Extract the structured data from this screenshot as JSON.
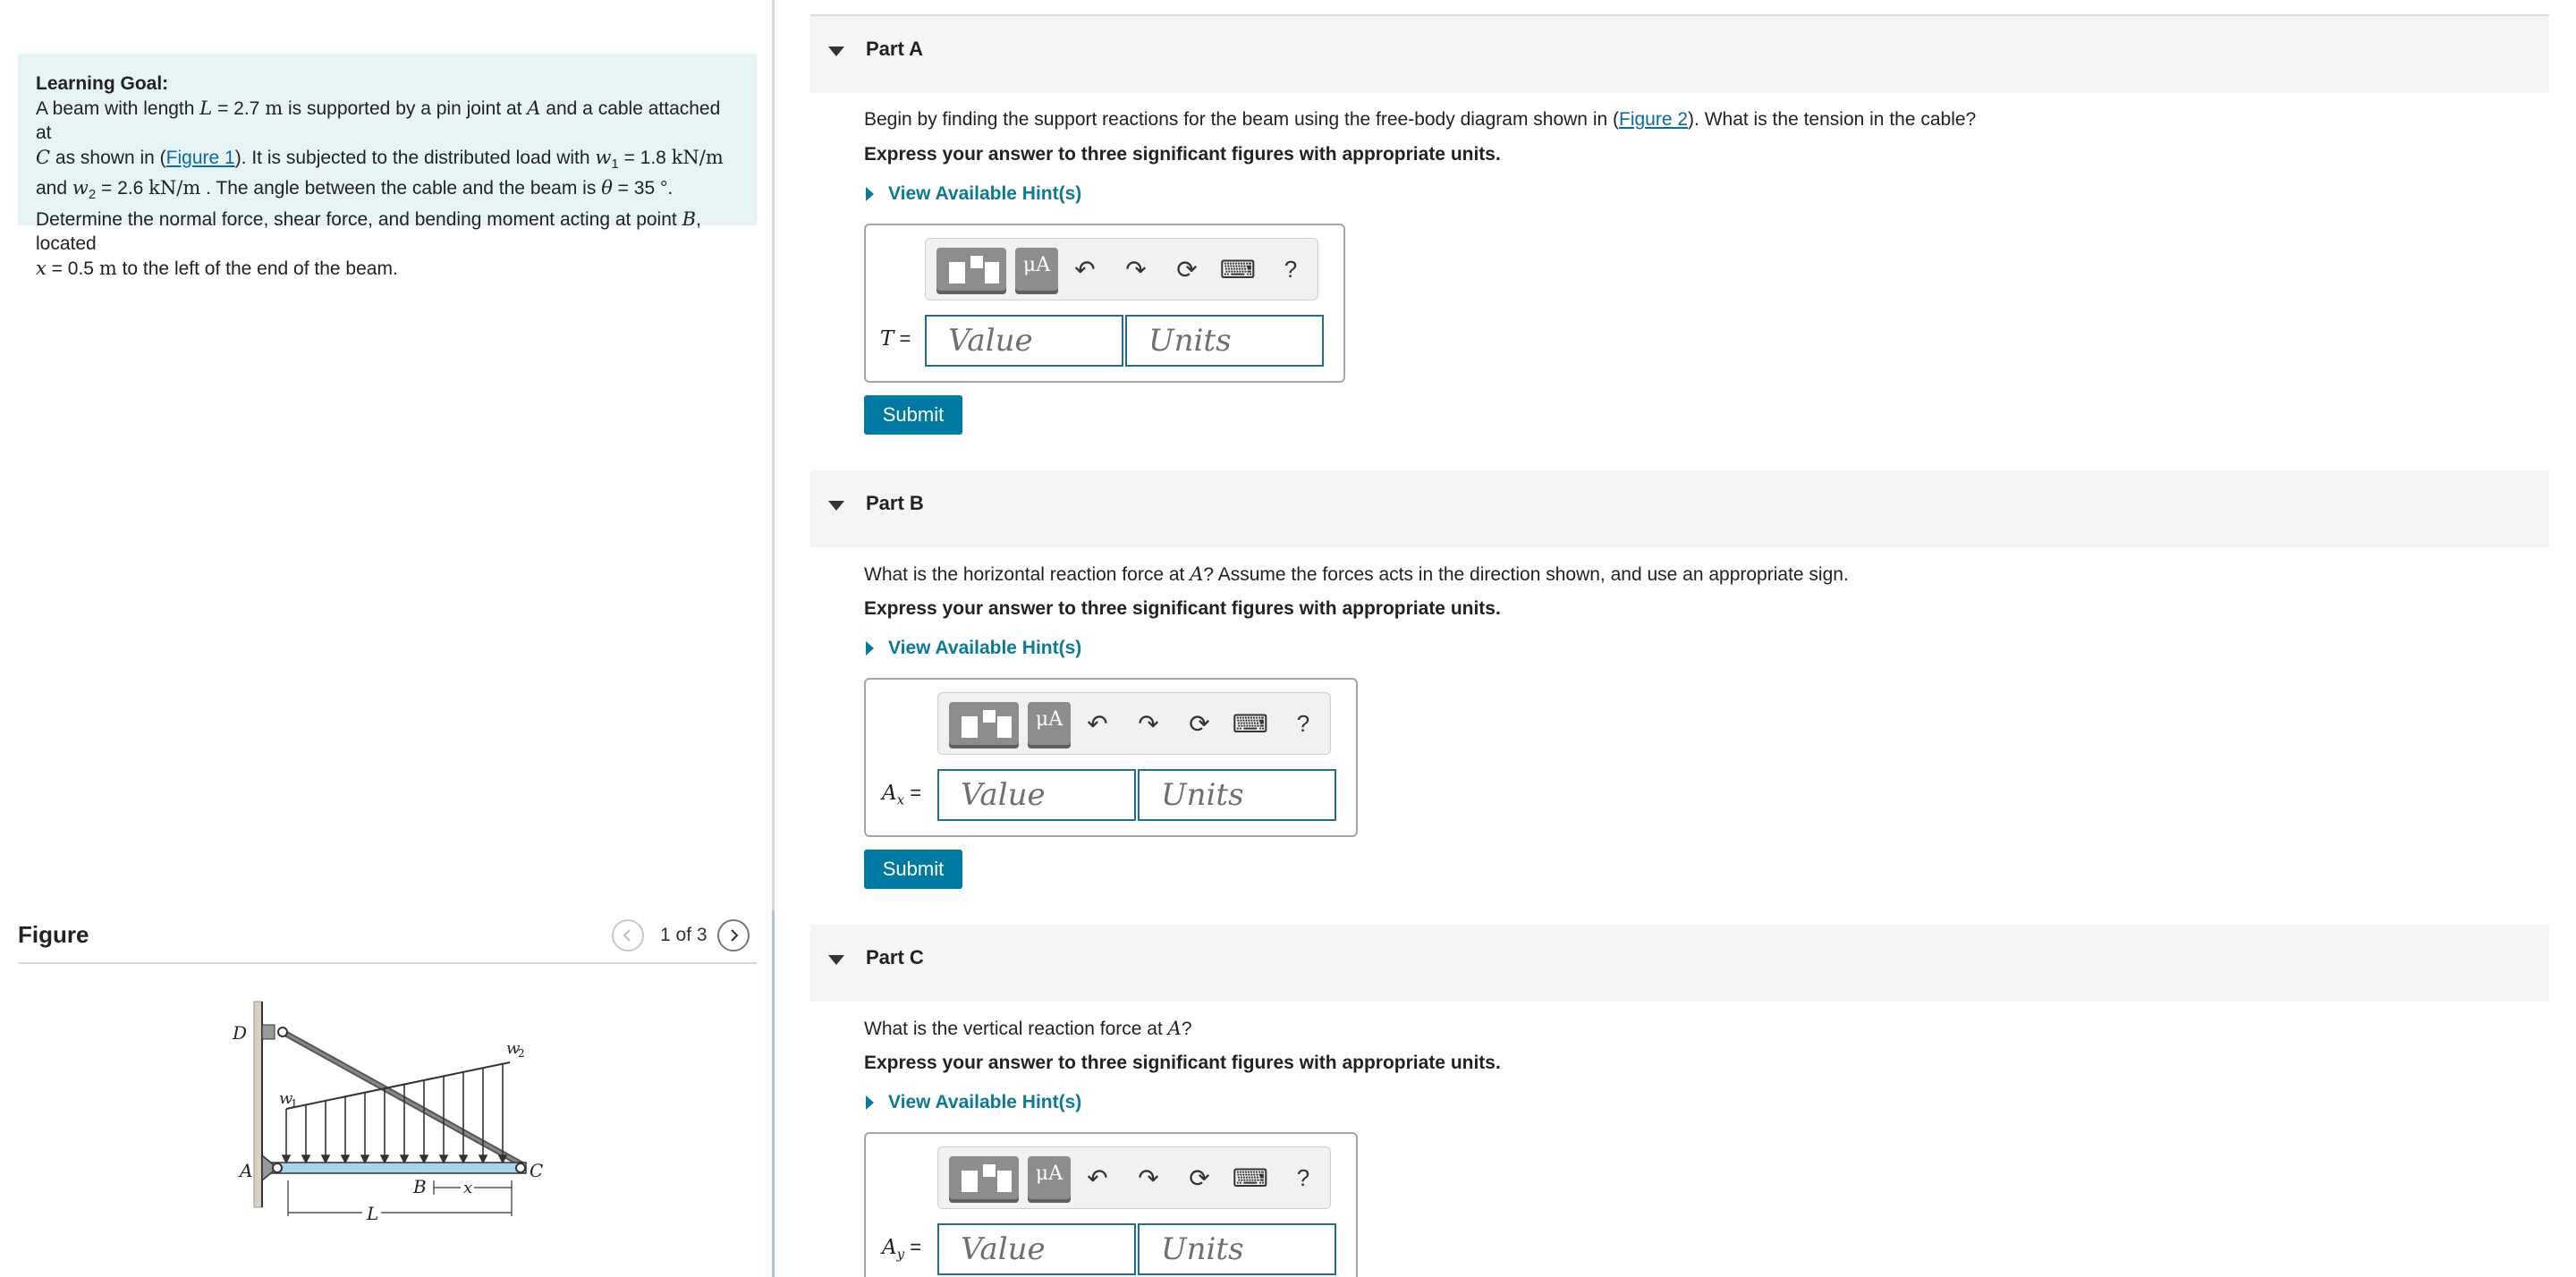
{
  "learning_goal": {
    "title": "Learning Goal:",
    "segments": {
      "s1": "A beam with length ",
      "L": "L",
      "s2": " = 2.7 ",
      "m1": "m",
      "s3": " is supported by a pin joint at ",
      "A": "A",
      "s4": " and a cable attached at",
      "C": "C",
      "s5": " as shown in (",
      "figure_link": "Figure 1",
      "s6": "). It is subjected to the distributed load with ",
      "w1": "w",
      "w1_sub": "1",
      "s7": " = 1.8 ",
      "u1": "kN/m",
      "s8": "and ",
      "w2": "w",
      "w2_sub": "2",
      "s9": " = 2.6 ",
      "u2": "kN/m",
      "s10": " . The angle between the cable and the beam is ",
      "theta": "θ",
      "s11": " = 35 °.",
      "s12": "Determine the normal force, shear force, and bending moment acting at point ",
      "B": "B",
      "s13": ", located",
      "x": "x",
      "s14": " = 0.5 ",
      "m2": "m",
      "s15": " to the left of the end of the beam."
    }
  },
  "figure_panel": {
    "title": "Figure",
    "counter": "1 of 3",
    "labels": {
      "D": "D",
      "A": "A",
      "C": "C",
      "B": "B",
      "x": "x",
      "L": "L",
      "w1": "w",
      "w1_sub": "1",
      "w2": "w",
      "w2_sub": "2"
    }
  },
  "parts": [
    {
      "title": "Part A",
      "question_pre": "Begin by finding the support reactions for the beam using the free-body diagram shown in (",
      "question_link": "Figure 2",
      "question_post": "). What is the tension in the cable?",
      "instruction": "Express your answer to three significant figures with appropriate units.",
      "hint": "View Available Hint(s)",
      "var": "T",
      "var_sub": "",
      "equals": " =",
      "value_placeholder": "Value",
      "units_placeholder": "Units",
      "submit": "Submit"
    },
    {
      "title": "Part B",
      "question_pre": "What is the horizontal reaction force at ",
      "question_var": "A",
      "question_post": "? Assume the forces acts in the direction shown, and use an appropriate sign.",
      "instruction": "Express your answer to three significant figures with appropriate units.",
      "hint": "View Available Hint(s)",
      "var": "A",
      "var_sub": "x",
      "equals": " =",
      "value_placeholder": "Value",
      "units_placeholder": "Units",
      "submit": "Submit"
    },
    {
      "title": "Part C",
      "question_pre": "What is the vertical reaction force at ",
      "question_var": "A",
      "question_post": "?",
      "instruction": "Express your answer to three significant figures with appropriate units.",
      "hint": "View Available Hint(s)",
      "var": "A",
      "var_sub": "y",
      "equals": " =",
      "value_placeholder": "Value",
      "units_placeholder": "Units"
    }
  ],
  "toolbar": {
    "mu_label": "μA",
    "help_label": "?",
    "icons": [
      "templates-icon",
      "units-icon",
      "undo-icon",
      "redo-icon",
      "reset-icon",
      "keyboard-icon",
      "help-icon"
    ]
  },
  "colors": {
    "accent": "#007aa2",
    "link": "#0b6aa0",
    "learning_goal_bg": "#e6f4f5",
    "beam": "#a9d3e8"
  }
}
